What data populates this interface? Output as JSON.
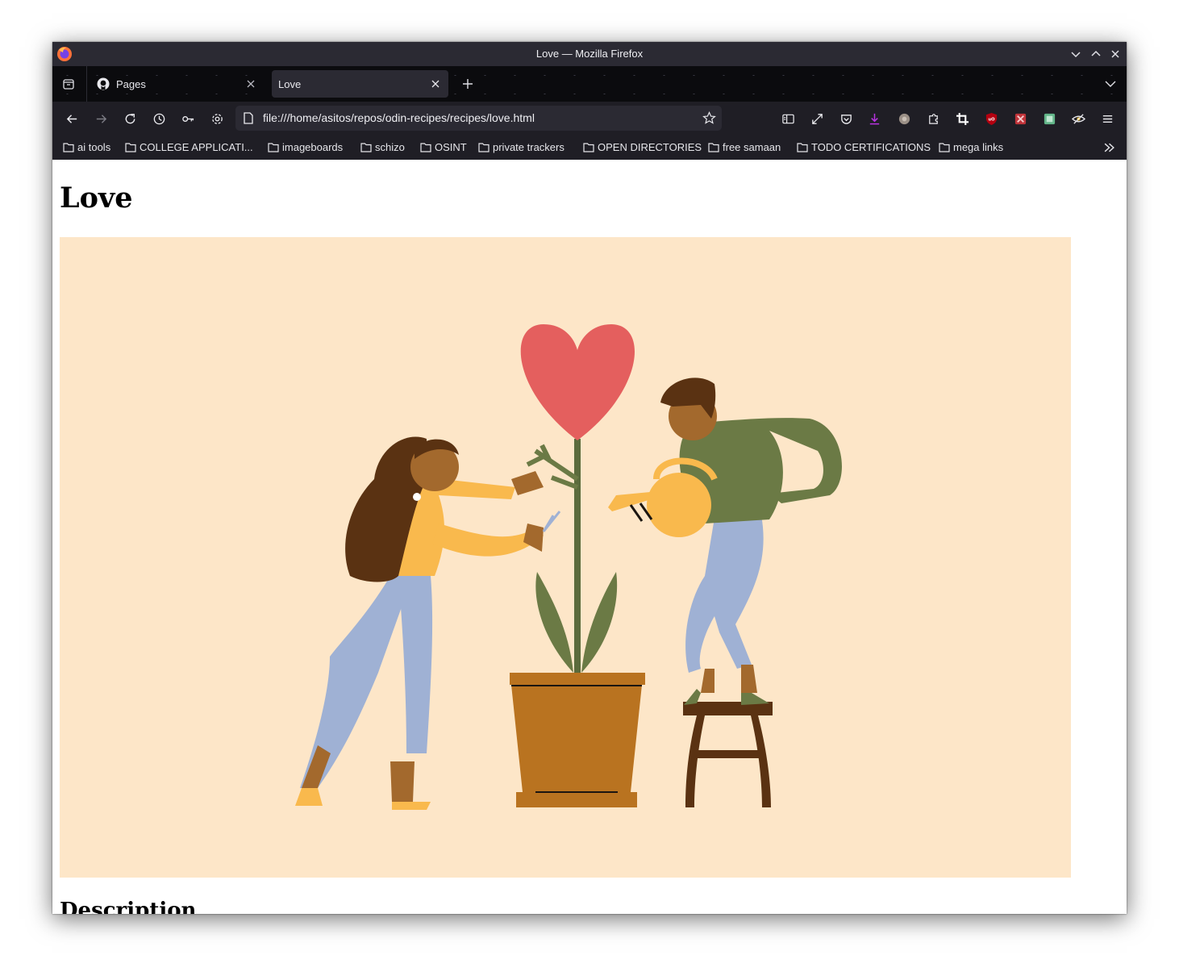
{
  "window": {
    "title": "Love — Mozilla Firefox"
  },
  "tabs": [
    {
      "label": "Pages",
      "active": false,
      "icon": "github-icon"
    },
    {
      "label": "Love",
      "active": true
    }
  ],
  "urlbar": {
    "url": "file:///home/asitos/repos/odin-recipes/recipes/love.html"
  },
  "bookmarks": [
    {
      "label": "ai tools"
    },
    {
      "label": "COLLEGE APPLICATI..."
    },
    {
      "label": "imageboards"
    },
    {
      "label": "schizo"
    },
    {
      "label": "OSINT"
    },
    {
      "label": "private trackers"
    },
    {
      "label": "OPEN DIRECTORIES"
    },
    {
      "label": "free samaan"
    },
    {
      "label": "TODO CERTIFICATIONS"
    },
    {
      "label": "mega links"
    }
  ],
  "page": {
    "heading": "Love",
    "image_description": "illustration: woman trimming and man watering a heart-shaped plant in a pot",
    "section_heading": "Description"
  },
  "colors": {
    "tab_bar": "#0b0b0e",
    "toolbar": "#1f1e25",
    "image_background": "#fde6c8",
    "heart": "#e45f5e"
  }
}
